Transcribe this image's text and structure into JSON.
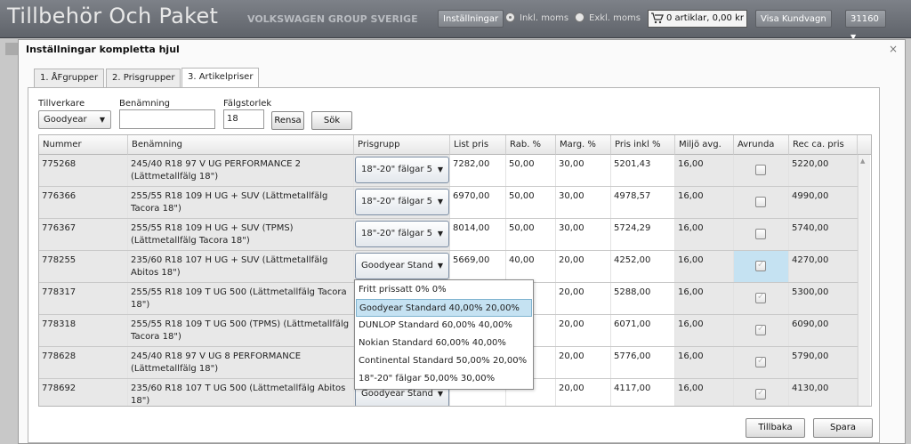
{
  "app": {
    "title": "Tillbehör Och Paket",
    "brand": "VOLKSWAGEN GROUP SVERIGE",
    "settings_label": "Inställningar",
    "incl_vat": "Inkl. moms",
    "excl_vat": "Exkl. moms",
    "cart_text": "0 artiklar, 0,00 kr",
    "show_cart": "Visa Kundvagn",
    "dealer_code": "31160"
  },
  "modal": {
    "title": "Inställningar kompletta hjul",
    "close": "×",
    "tabs": [
      "1. ÅFgrupper",
      "2. Prisgrupper",
      "3. Artikelpriser"
    ],
    "active_tab": 2
  },
  "filters": {
    "manufacturer_label": "Tillverkare",
    "manufacturer_value": "Goodyear",
    "name_label": "Benämning",
    "name_value": "",
    "rim_label": "Fälgstorlek",
    "rim_value": "18",
    "clear_label": "Rensa",
    "search_label": "Sök"
  },
  "grid": {
    "columns": [
      "Nummer",
      "Benämning",
      "Prisgrupp",
      "List pris",
      "Rab. %",
      "Marg. %",
      "Pris inkl %",
      "Miljö avg.",
      "Avrunda",
      "Rec ca. pris"
    ],
    "rows": [
      {
        "nummer": "775268",
        "benamning": "245/40 R18 97 V UG PERFORMANCE 2 (Lättmetallfälg 18\")",
        "prisgrupp": "18\"-20\" fälgar 5",
        "list": "7282,00",
        "rab": "50,00",
        "marg": "30,00",
        "prisinkl": "5201,43",
        "miljo": "16,00",
        "avrunda": false,
        "rec": "5220,00"
      },
      {
        "nummer": "776366",
        "benamning": "255/55 R18 109 H UG + SUV (Lättmetallfälg Tacora 18\")",
        "prisgrupp": "18\"-20\" fälgar 5",
        "list": "6970,00",
        "rab": "50,00",
        "marg": "30,00",
        "prisinkl": "4978,57",
        "miljo": "16,00",
        "avrunda": false,
        "rec": "4990,00"
      },
      {
        "nummer": "776367",
        "benamning": "255/55 R18 109 H UG + SUV (TPMS) (Lättmetallfälg Tacora 18\")",
        "prisgrupp": "18\"-20\" fälgar 5",
        "list": "8014,00",
        "rab": "50,00",
        "marg": "30,00",
        "prisinkl": "5724,29",
        "miljo": "16,00",
        "avrunda": false,
        "rec": "5740,00"
      },
      {
        "nummer": "778255",
        "benamning": "235/60 R18 107 H UG + SUV (Lättmetallfälg Abitos 18\")",
        "prisgrupp": "Goodyear Stand",
        "list": "5669,00",
        "rab": "40,00",
        "marg": "20,00",
        "prisinkl": "4252,00",
        "miljo": "16,00",
        "avrunda": true,
        "rec": "4270,00"
      },
      {
        "nummer": "778317",
        "benamning": "255/55 R18 109 T UG 500 (Lättmetallfälg Tacora 18\")",
        "prisgrupp": "",
        "list": "",
        "rab": "",
        "marg": "20,00",
        "prisinkl": "5288,00",
        "miljo": "16,00",
        "avrunda": true,
        "rec": "5300,00"
      },
      {
        "nummer": "778318",
        "benamning": "255/55 R18 109 T UG 500 (TPMS) (Lättmetallfälg Tacora 18\")",
        "prisgrupp": "",
        "list": "",
        "rab": "",
        "marg": "20,00",
        "prisinkl": "6071,00",
        "miljo": "16,00",
        "avrunda": true,
        "rec": "6090,00"
      },
      {
        "nummer": "778628",
        "benamning": "245/40 R18 97 V UG 8 PERFORMANCE (Lättmetallfälg 18\")",
        "prisgrupp": "",
        "list": "",
        "rab": "",
        "marg": "20,00",
        "prisinkl": "5776,00",
        "miljo": "16,00",
        "avrunda": true,
        "rec": "5790,00"
      },
      {
        "nummer": "778692",
        "benamning": "235/60 R18 107 T UG 500 (Lättmetallfälg Abitos 18\")",
        "prisgrupp": "Goodyear Stand",
        "list": "",
        "rab": "",
        "marg": "20,00",
        "prisinkl": "4117,00",
        "miljo": "16,00",
        "avrunda": true,
        "rec": "4130,00"
      }
    ]
  },
  "dropdown_options": [
    "Fritt prissatt 0% 0%",
    "Goodyear Standard 40,00% 20,00%",
    "DUNLOP Standard 60,00% 40,00%",
    "Nokian Standard 60,00% 40,00%",
    "Continental Standard 50,00% 20,00%",
    "18\"-20\" fälgar 50,00% 30,00%"
  ],
  "dropdown_highlighted": 1,
  "footer": {
    "back_label": "Tillbaka",
    "save_label": "Spara"
  }
}
